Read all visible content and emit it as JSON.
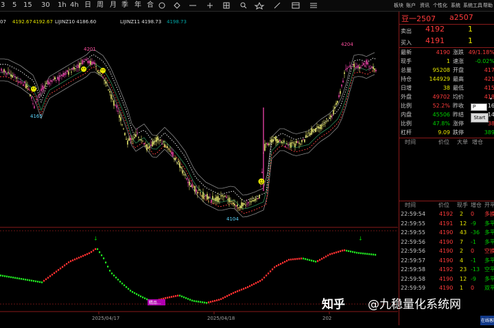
{
  "toolbar": {
    "periods": [
      "3",
      "5",
      "15",
      "30",
      "1h",
      "4h",
      "日",
      "周",
      "月",
      "季",
      "年",
      "合"
    ],
    "icons": [
      "circle-icon",
      "diamond-icon",
      "minus-icon",
      "plus-icon",
      "grid-icon",
      "search-icon",
      "star-icon",
      "draw-icon",
      "layout-icon",
      "menu-icon"
    ],
    "right_menu": [
      "板块",
      "账户",
      "资讯",
      "个性化",
      "系统",
      "系统工具",
      "帮助"
    ]
  },
  "indicator_bar": {
    "items": [
      {
        "label": "07",
        "color": "#e0e0e0"
      },
      {
        "label": "4192.67",
        "color": "#e6e600"
      },
      {
        "label": "4192.67",
        "color": "#e6e600"
      },
      {
        "label": "LIJINZ10 4186.60",
        "color": "#e0e0e0"
      },
      {
        "label": "",
        "color": "#3c6cff"
      },
      {
        "label": "LIJINZ11 4198.73",
        "color": "#e0e0e0"
      },
      {
        "label": "4198.73",
        "color": "#00a8a8"
      }
    ]
  },
  "chart_labels": {
    "high1": "4201",
    "low1": "4165",
    "low2": "4104",
    "high2": "4204",
    "date1": "2025/04/17",
    "date2": "2025/04/18",
    "date3": "202",
    "osc_tag": "精品..."
  },
  "quote": {
    "title": "豆一2507",
    "code": "a2507",
    "sell": {
      "label": "卖出",
      "price": "4192",
      "vol": "1"
    },
    "buy": {
      "label": "买入",
      "price": "4191",
      "vol": "1"
    },
    "rows": [
      {
        "l1": "最新",
        "v1": "4190",
        "l2": "涨跌",
        "v2": "49/1.18%"
      },
      {
        "l1": "现手",
        "v1": "1",
        "l2": "速涨",
        "v2": "-0.02%"
      },
      {
        "l1": "总量",
        "v1": "95208",
        "l2": "开盘",
        "v2": "417"
      },
      {
        "l1": "持仓",
        "v1": "144929",
        "l2": "最高",
        "v2": "421"
      },
      {
        "l1": "日增",
        "v1": "38",
        "l2": "最低",
        "v2": "415"
      },
      {
        "l1": "外盘",
        "v1": "49702",
        "l2": "均价",
        "v2": "418"
      },
      {
        "l1": "比例",
        "v1": "52.2%",
        "l2": "昨收",
        "v2": "16"
      },
      {
        "l1": "内盘",
        "v1": "45506",
        "l2": "昨结",
        "v2": "14"
      },
      {
        "l1": "比例",
        "v1": "47.8%",
        "l2": "涨停",
        "v2": "38"
      },
      {
        "l1": "杠杆",
        "v1": "9.09",
        "l2": "跌停",
        "v2": "389"
      }
    ],
    "input_value": "P",
    "start_label": "Start",
    "tick_header1": [
      "时间",
      "价位",
      "大单",
      "增仓"
    ],
    "tick_header2": [
      "时间",
      "价位",
      "现手",
      "增仓",
      "开平"
    ],
    "ticks": [
      {
        "t": "22:59:54",
        "p": "4192",
        "v": "2",
        "c": "0",
        "d": "多换"
      },
      {
        "t": "22:59:55",
        "p": "4191",
        "v": "12",
        "c": "-9",
        "d": "多平"
      },
      {
        "t": "22:59:55",
        "p": "4190",
        "v": "43",
        "c": "-36",
        "d": "多平"
      },
      {
        "t": "22:59:56",
        "p": "4190",
        "v": "7",
        "c": "-1",
        "d": "多平"
      },
      {
        "t": "22:59:56",
        "p": "4190",
        "v": "2",
        "c": "0",
        "d": "空换"
      },
      {
        "t": "22:59:57",
        "p": "4190",
        "v": "4",
        "c": "-1",
        "d": "多平"
      },
      {
        "t": "22:59:58",
        "p": "4192",
        "v": "23",
        "c": "-13",
        "d": "空平"
      },
      {
        "t": "22:59:58",
        "p": "4190",
        "v": "12",
        "c": "-9",
        "d": "多平"
      },
      {
        "t": "22:59:59",
        "p": "4190",
        "v": "1",
        "c": "0",
        "d": "双平"
      }
    ]
  },
  "watermark": {
    "brand": "知乎",
    "text": "@九稳量化系统网"
  },
  "corner_badge": "在线客服"
}
